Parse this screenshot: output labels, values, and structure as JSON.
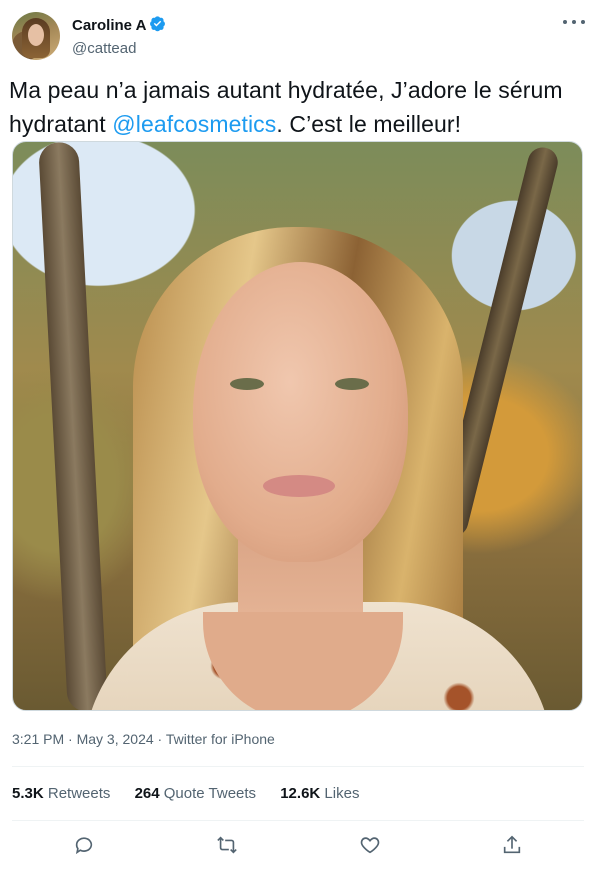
{
  "tweet": {
    "display_name": "Caroline A",
    "verified": true,
    "handle": "@cattead",
    "text_before": "Ma peau n’a jamais autant hydratée, J’adore le sérum hydratant ",
    "mention": "@leafcosmetics",
    "text_after": ". C’est le meilleur!",
    "time": "3:21 PM",
    "separator": " · ",
    "date": "May 3, 2024",
    "source": "Twitter for iPhone"
  },
  "stats": [
    {
      "count": "5.3K",
      "label": "Retweets"
    },
    {
      "count": "264",
      "label": "Quote Tweets"
    },
    {
      "count": "12.6K",
      "label": "Likes"
    }
  ],
  "actions": [
    "reply-icon",
    "retweet-icon",
    "like-icon",
    "share-icon"
  ],
  "colors": {
    "accent": "#1d9bf0",
    "text": "#0f1419",
    "secondary": "#536471",
    "divider": "#eff3f4"
  }
}
